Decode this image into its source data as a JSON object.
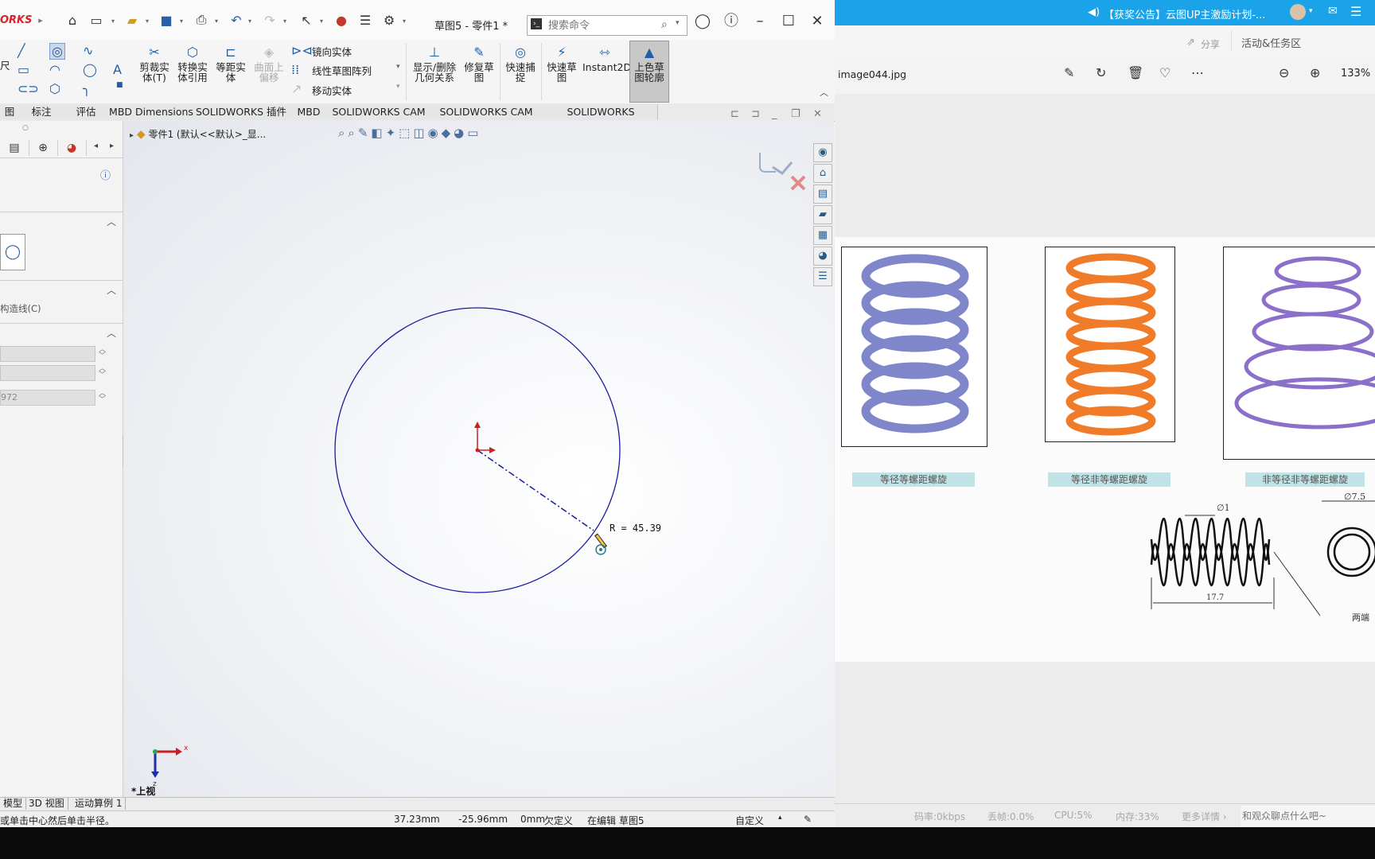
{
  "solidworks": {
    "logo": "ORKS",
    "doc_title": "草图5 - 零件1 *",
    "search_placeholder": "搜索命令",
    "ribbon": {
      "left_label": "尺",
      "trim": "剪裁实体(T)",
      "trim_1": "剪裁实",
      "trim_2": "体(T)",
      "convert_1": "转换实",
      "convert_2": "体引用",
      "offset_1": "等距实",
      "offset_2": "体",
      "surface_offset_1": "曲面上",
      "surface_offset_2": "偏移",
      "mirror": "镜向实体",
      "linear_pattern": "线性草图阵列",
      "move": "移动实体",
      "show_relations_1": "显示/删除",
      "show_relations_2": "几何关系",
      "repair_1": "修复草",
      "repair_2": "图",
      "quick_snap_1": "快速捕",
      "quick_snap_2": "捉",
      "rapid_sketch_1": "快速草",
      "rapid_sketch_2": "图",
      "instant2d": "Instant2D",
      "shaded_1": "上色草",
      "shaded_2": "图轮廓"
    },
    "tabs": [
      "图",
      "标注",
      "评估",
      "MBD Dimensions",
      "SOLIDWORKS 插件",
      "MBD",
      "SOLIDWORKS CAM",
      "SOLIDWORKS CAM TBM",
      "SOLIDWORKS Inspection"
    ],
    "feature_tree_label": "零件1  (默认<<默认>_显...",
    "left_pane": {
      "construction_label": "构造线(C)",
      "field3_value": "972"
    },
    "sketch": {
      "radius_label": "R = 45.39"
    },
    "axis": {
      "x": "x",
      "z": "z"
    },
    "view_label": "*上视",
    "bottom_tabs": [
      "模型",
      "3D 视图",
      "运动算例 1"
    ],
    "status": {
      "hint": "或单击中心然后单击半径。",
      "x": "37.23mm",
      "y": "-25.96mm",
      "z": "0mm",
      "state": "欠定义",
      "editing": "在编辑 草图5",
      "units": "自定义"
    }
  },
  "viewer": {
    "announcement": "【获奖公告】云图UP主激励计划-...",
    "share": "分享",
    "activity": "活动&任务区",
    "filename": "image044.jpg",
    "zoom": "133%",
    "captions": [
      "等径等螺距螺旋",
      "等径非等螺距螺旋",
      "非等径非等螺距螺旋"
    ],
    "dims": {
      "d1": "∅1",
      "len": "17.7",
      "d2": "∅7.5",
      "note": "两端"
    },
    "status": {
      "bitrate": "码率:0kbps",
      "loss": "丢帧:0.0%",
      "cpu": "CPU:5%",
      "mem": "内存:33%",
      "more": "更多详情 ›",
      "chat_placeholder": "和观众聊点什么吧~"
    }
  },
  "colors": {
    "accent_blue": "#1aa3e8",
    "sketch_line": "#1a1a9e",
    "spring_blue": "#7f86c9",
    "spring_orange": "#f07c2a",
    "spring_purple": "#8b6fc9"
  }
}
